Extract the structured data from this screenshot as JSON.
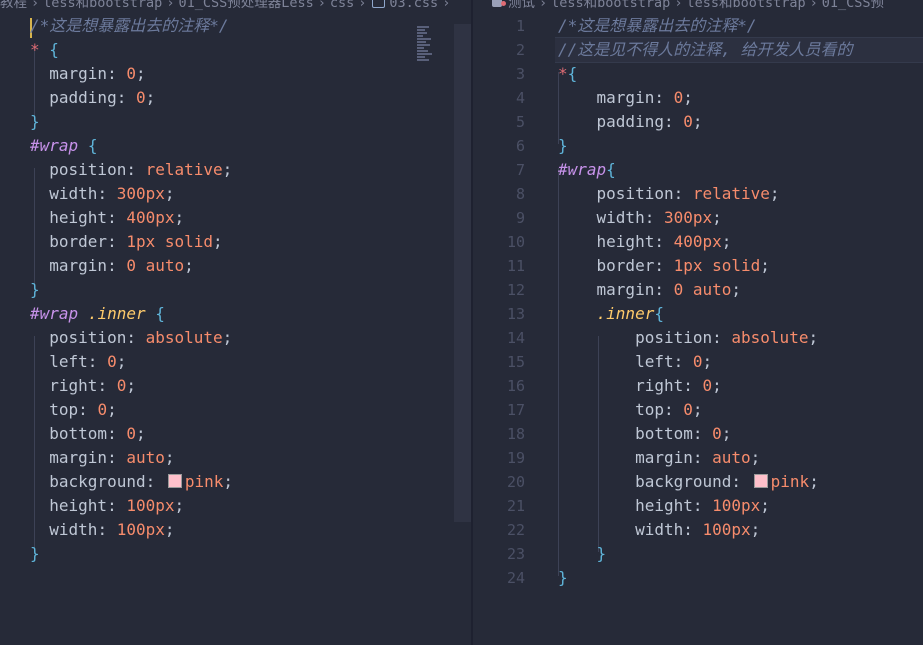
{
  "breadcrumb_left": {
    "items": [
      "教程",
      "less和bootstrap",
      "01_CSS预处理器Less",
      "css",
      "03.css"
    ]
  },
  "breadcrumb_right": {
    "items": [
      "测试",
      "less和bootstrap",
      "less和bootstrap",
      "01_CSS预"
    ]
  },
  "colors": {
    "background": "#262a38",
    "comment": "#6c7a9c",
    "selector_star": "#e06c75",
    "brace": "#5fb4d9",
    "property": "#bfc7d5",
    "number": "#f78c6c",
    "id_selector": "#c792ea",
    "class_selector": "#ffcb6b",
    "swatch_pink": "#ffc0cb"
  },
  "icons": {
    "file": "css-file-icon",
    "preview": "preview-icon"
  },
  "left_editor": {
    "comment": "/*这是想暴露出去的注释*/",
    "lines": {
      "l2_sel": "*",
      "l2_open": "{",
      "l3_prop": "margin",
      "l3_val": "0",
      "l4_prop": "padding",
      "l4_val": "0",
      "l5_close": "}",
      "l6_id": "#wrap",
      "l6_open": "{",
      "l7_prop": "position",
      "l7_val": "relative",
      "l8_prop": "width",
      "l8_val": "300px",
      "l9_prop": "height",
      "l9_val": "400px",
      "l10_prop": "border",
      "l10_val": "1px solid",
      "l11_prop": "margin",
      "l11_val": "0 auto",
      "l12_close": "}",
      "l13_id": "#wrap",
      "l13_class": ".inner",
      "l13_open": "{",
      "l14_prop": "position",
      "l14_val": "absolute",
      "l15_prop": "left",
      "l15_val": "0",
      "l16_prop": "right",
      "l16_val": "0",
      "l17_prop": "top",
      "l17_val": "0",
      "l18_prop": "bottom",
      "l18_val": "0",
      "l19_prop": "margin",
      "l19_val": "auto",
      "l20_prop": "background",
      "l20_val": "pink",
      "l21_prop": "height",
      "l21_val": "100px",
      "l22_prop": "width",
      "l22_val": "100px",
      "l23_close": "}"
    }
  },
  "right_editor": {
    "line_numbers": [
      "1",
      "2",
      "3",
      "4",
      "5",
      "6",
      "7",
      "8",
      "9",
      "10",
      "11",
      "12",
      "13",
      "14",
      "15",
      "16",
      "17",
      "18",
      "19",
      "20",
      "21",
      "22",
      "23",
      "24"
    ],
    "lines": {
      "l1": "/*这是想暴露出去的注释*/",
      "l2": "//这是见不得人的注释, 给开发人员看的",
      "l3_sel": "*",
      "l3_open": "{",
      "l4_prop": "margin",
      "l4_val": "0",
      "l5_prop": "padding",
      "l5_val": "0",
      "l6_close": "}",
      "l7_id": "#wrap",
      "l7_open": "{",
      "l8_prop": "position",
      "l8_val": "relative",
      "l9_prop": "width",
      "l9_val": "300px",
      "l10_prop": "height",
      "l10_val": "400px",
      "l11_prop": "border",
      "l11_val": "1px solid",
      "l12_prop": "margin",
      "l12_val": "0 auto",
      "l13_class": ".inner",
      "l13_open": "{",
      "l14_prop": "position",
      "l14_val": "absolute",
      "l15_prop": "left",
      "l15_val": "0",
      "l16_prop": "right",
      "l16_val": "0",
      "l17_prop": "top",
      "l17_val": "0",
      "l18_prop": "bottom",
      "l18_val": "0",
      "l19_prop": "margin",
      "l19_val": "auto",
      "l20_prop": "background",
      "l20_val": "pink",
      "l21_prop": "height",
      "l21_val": "100px",
      "l22_prop": "width",
      "l22_val": "100px",
      "l23_close": "}",
      "l24_close": "}"
    }
  }
}
